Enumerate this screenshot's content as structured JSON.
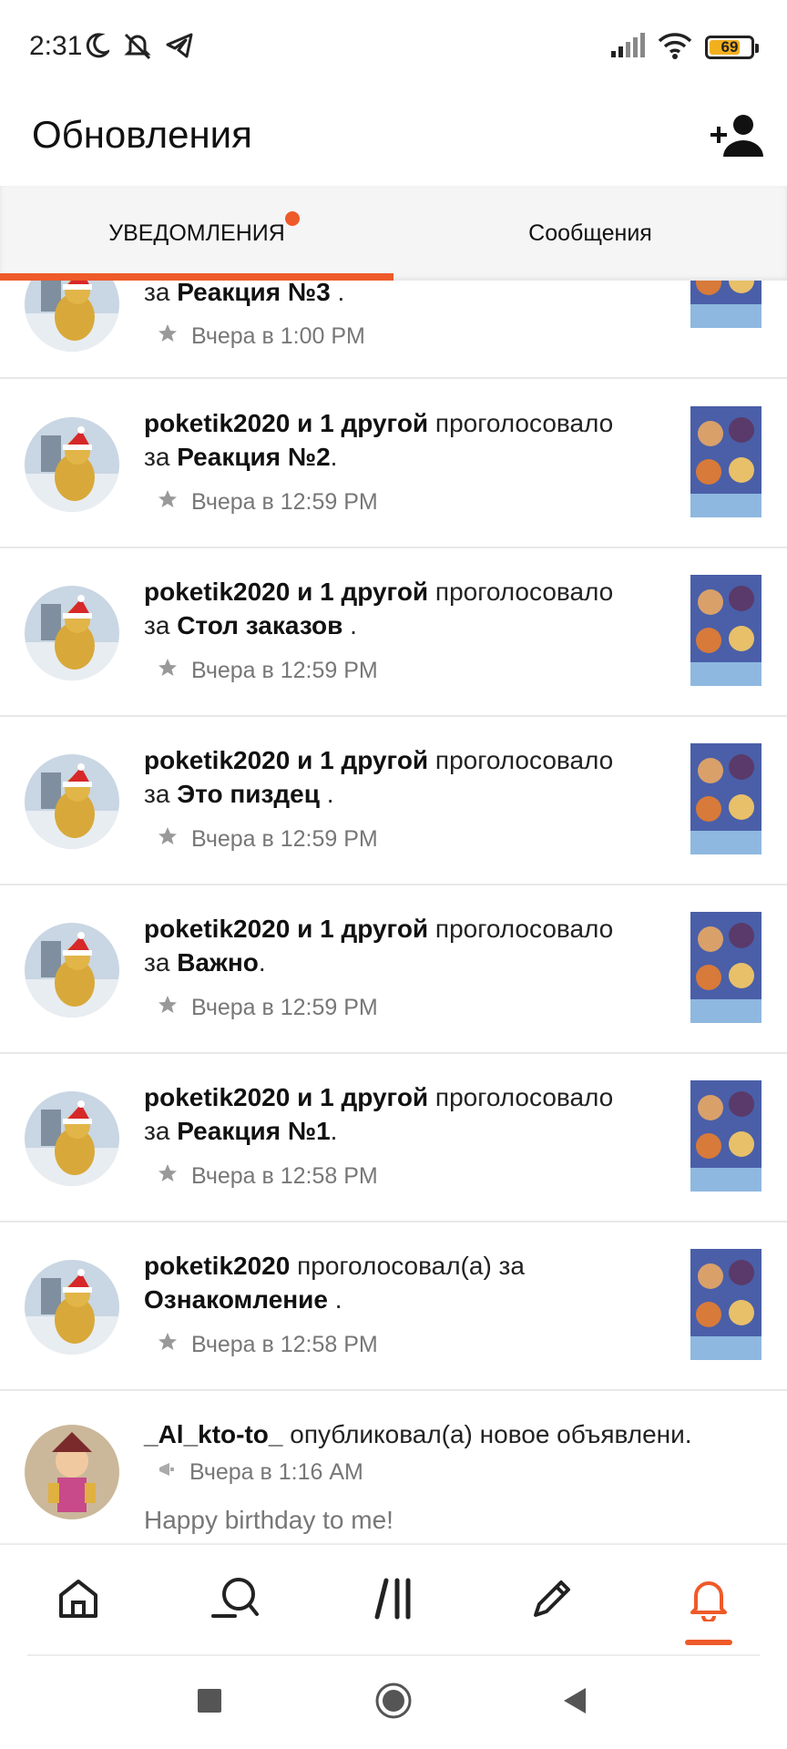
{
  "status_bar": {
    "time": "2:31",
    "battery_level": "69",
    "icons": [
      "moon-icon",
      "bell-muted-icon",
      "telegram-icon",
      "signal-icon",
      "wifi-icon",
      "battery-icon"
    ]
  },
  "header": {
    "title": "Обновления",
    "add_user_icon": "add-user-icon"
  },
  "tabs": [
    {
      "label": "УВЕДОМЛЕНИЯ",
      "active": true,
      "has_badge": true
    },
    {
      "label": "Сообщения",
      "active": false,
      "has_badge": false
    }
  ],
  "colors": {
    "accent": "#ee5a2a",
    "text_primary": "#111111",
    "text_secondary": "#777777",
    "tabs_bg": "#f5f5f5"
  },
  "notifications": [
    {
      "line1_prefix": "",
      "line1_bold": "",
      "line1_rest": "",
      "line2_prefix": "за ",
      "line2_bold": "Реакция №3",
      "line2_rest": " .",
      "time": "Вчера в 1:00 PM",
      "meta_icon": "star-icon"
    },
    {
      "line1_prefix": "",
      "line1_bold": "poketik2020 и 1 другой",
      "line1_rest": " проголосовало",
      "line2_prefix": "за ",
      "line2_bold": "Реакция №2",
      "line2_rest": ".",
      "time": "Вчера в 12:59 PM",
      "meta_icon": "star-icon"
    },
    {
      "line1_prefix": "",
      "line1_bold": "poketik2020 и 1 другой",
      "line1_rest": " проголосовало",
      "line2_prefix": "за ",
      "line2_bold": "Стол заказов",
      "line2_rest": " .",
      "time": "Вчера в 12:59 PM",
      "meta_icon": "star-icon"
    },
    {
      "line1_prefix": "",
      "line1_bold": "poketik2020 и 1 другой",
      "line1_rest": " проголосовало",
      "line2_prefix": "за ",
      "line2_bold": "Это пиздец",
      "line2_rest": " .",
      "time": "Вчера в 12:59 PM",
      "meta_icon": "star-icon"
    },
    {
      "line1_prefix": "",
      "line1_bold": "poketik2020 и 1 другой",
      "line1_rest": " проголосовало",
      "line2_prefix": "за ",
      "line2_bold": "Важно",
      "line2_rest": ".",
      "time": "Вчера в 12:59 PM",
      "meta_icon": "star-icon"
    },
    {
      "line1_prefix": "",
      "line1_bold": "poketik2020 и 1 другой",
      "line1_rest": " проголосовало",
      "line2_prefix": "за ",
      "line2_bold": "Реакция №1",
      "line2_rest": ".",
      "time": "Вчера в 12:58 PM",
      "meta_icon": "star-icon"
    },
    {
      "line1_prefix": "",
      "line1_bold": "poketik2020",
      "line1_rest": " проголосовал(а) за",
      "line2_prefix": "",
      "line2_bold": "Ознакомление",
      "line2_rest": " .",
      "time": "Вчера в 12:58 PM",
      "meta_icon": "star-icon"
    },
    {
      "line1_prefix": "",
      "line1_bold": "_Al_kto-to_",
      "line1_rest": " опубликовал(а) новое объявлени.",
      "line2_prefix": "",
      "line2_bold": "",
      "line2_rest": "",
      "time": "Вчера в 1:16 AM",
      "meta_icon": "megaphone-icon",
      "preview": "Happy birthday to me!"
    }
  ],
  "bottom_nav": [
    {
      "name": "home",
      "icon": "home-icon"
    },
    {
      "name": "search",
      "icon": "search-icon"
    },
    {
      "name": "feed",
      "icon": "feed-icon"
    },
    {
      "name": "compose",
      "icon": "pencil-icon"
    },
    {
      "name": "notifications",
      "icon": "bell-icon",
      "active": true
    }
  ],
  "system_nav": [
    "recents-icon",
    "home-circle-icon",
    "back-icon"
  ]
}
